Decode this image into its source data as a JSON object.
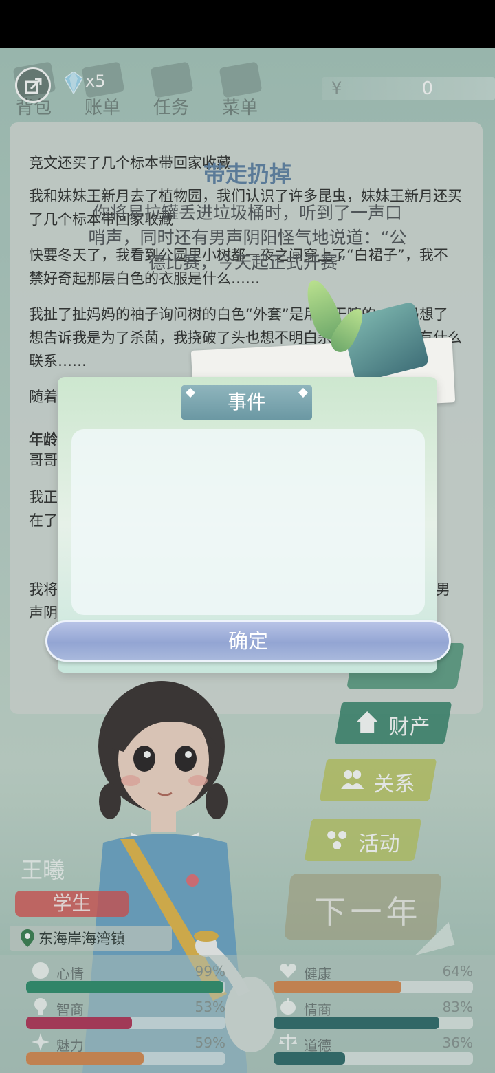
{
  "top": {
    "gem_count": "x5",
    "money_symbol": "¥",
    "money_value": "0",
    "tabs": [
      {
        "label": "背包",
        "icon": "bag-icon"
      },
      {
        "label": "账单",
        "icon": "bill-icon"
      },
      {
        "label": "任务",
        "icon": "task-icon"
      },
      {
        "label": "菜单",
        "icon": "menu-icon"
      }
    ]
  },
  "story": [
    "竞文还买了几个标本带回家收藏",
    "我和妹妹王新月去了植物园，我们认识了许多昆虫，妹妹王新月还买了几个标本带回家收藏",
    "快要冬天了，我看到公园里小树都一夜之间穿上了“白裙子”，我不禁好奇起那层白色的衣服是什么……",
    "我扯了扯妈妈的袖子询问树的白色“外套”是用来干嘛的，妈妈想了想告诉我是为了杀菌，我挠破了头也想不明白杀菌和保暖之间有什么联系……",
    "随着奔",
    "年龄",
    "哥哥",
    "我正",
    "在了",
    "我将",
    "声阴"
  ],
  "story_right_fragments": [
    "男"
  ],
  "sidebar": {
    "property": "财产",
    "relations": "关系",
    "activity": "活动",
    "next_year": "下一年"
  },
  "player": {
    "name": "王曦",
    "role": "学生",
    "location": "东海岸海湾镇"
  },
  "stats": [
    {
      "name": "心情",
      "percent": "99%",
      "value": 0.99,
      "color": "#2f8f6e",
      "icon": "smile-icon"
    },
    {
      "name": "健康",
      "percent": "64%",
      "value": 0.64,
      "color": "#d88a52",
      "icon": "heart-icon"
    },
    {
      "name": "智商",
      "percent": "53%",
      "value": 0.53,
      "color": "#b3365a",
      "icon": "bulb-icon"
    },
    {
      "name": "情商",
      "percent": "83%",
      "value": 0.83,
      "color": "#2f6b6b",
      "icon": "apple-icon"
    },
    {
      "name": "魅力",
      "percent": "59%",
      "value": 0.59,
      "color": "#d88a52",
      "icon": "sparkle-icon"
    },
    {
      "name": "道德",
      "percent": "36%",
      "value": 0.36,
      "color": "#2f6b6b",
      "icon": "scale-icon"
    }
  ],
  "modal": {
    "header": "事件",
    "title": "带走扔掉",
    "body": "你将易拉罐丢进垃圾桶时，听到了一声口哨声，同时还有男声阴阳怪气地说道：“公德比赛，今天起正式开赛”",
    "confirm": "确定"
  }
}
